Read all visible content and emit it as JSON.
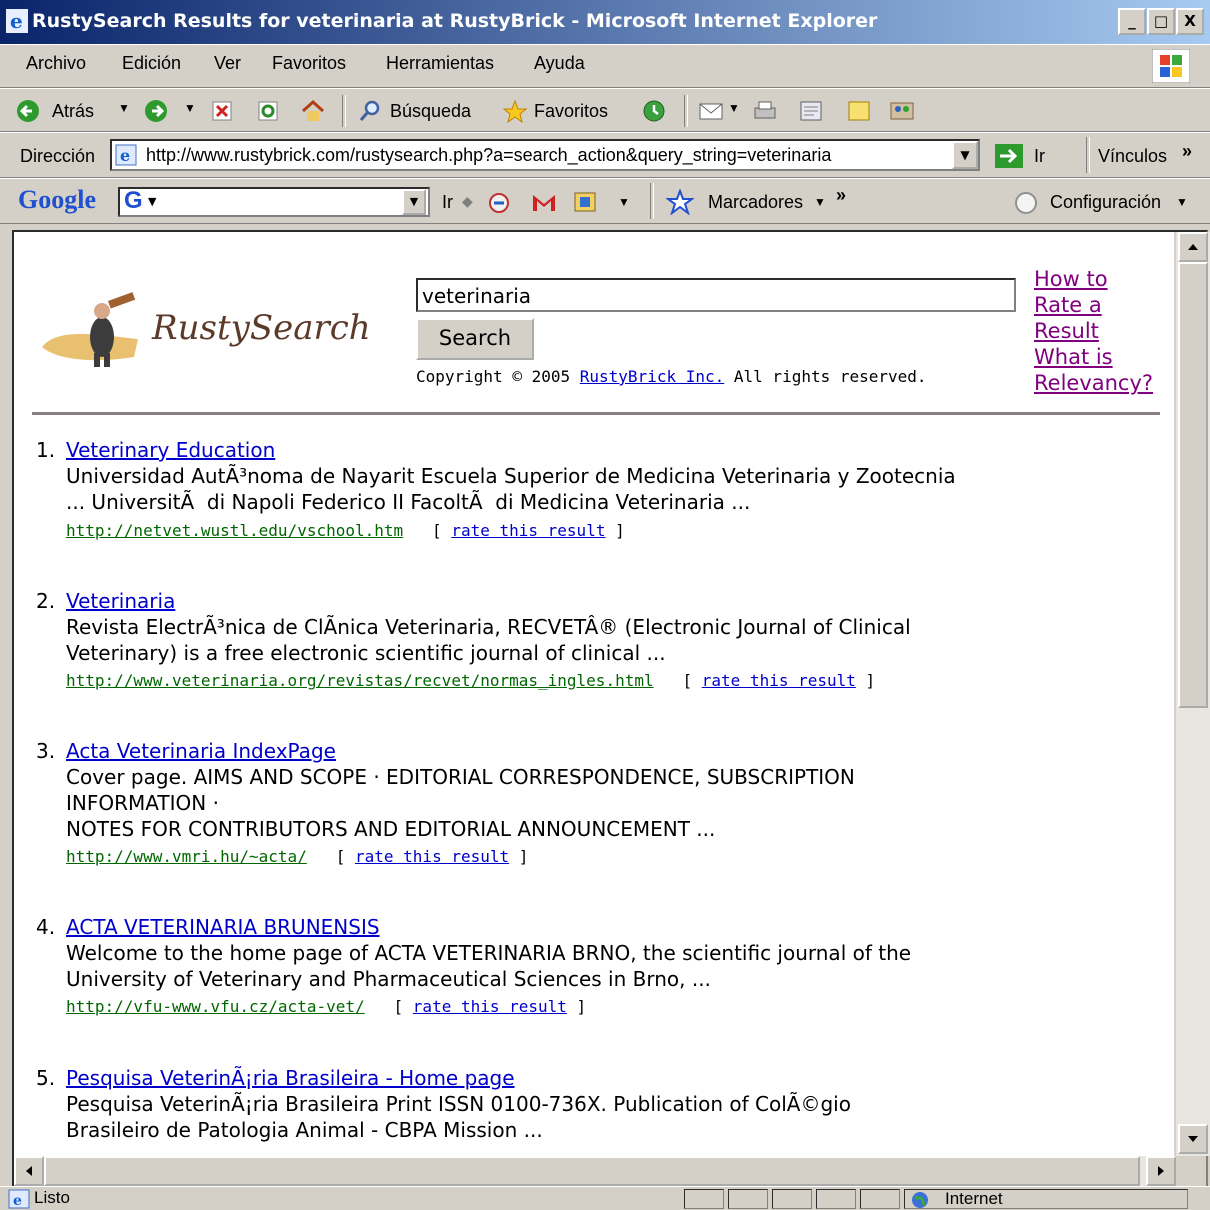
{
  "window": {
    "title": "RustySearch Results for veterinaria at RustyBrick - Microsoft Internet Explorer",
    "min_label": "_",
    "max_label": "□",
    "close_label": "X"
  },
  "menu": {
    "items": [
      "Archivo",
      "Edición",
      "Ver",
      "Favoritos",
      "Herramientas",
      "Ayuda"
    ]
  },
  "toolbar": {
    "back_label": "Atrás",
    "search_label": "Búsqueda",
    "favorites_label": "Favoritos"
  },
  "address": {
    "label": "Dirección",
    "url": "http://www.rustybrick.com/rustysearch.php?a=search_action&query_string=veterinaria",
    "go_label": "Ir",
    "links_label": "Vínculos",
    "more": "»"
  },
  "google_bar": {
    "logo": "Google",
    "g_icon": "G",
    "go_label": "Ir",
    "bookmarks_label": "Marcadores",
    "more": "»",
    "settings_label": "Configuración"
  },
  "page": {
    "brand": "RustySearch",
    "query": "veterinaria",
    "search_button": "Search",
    "copyright_prefix": "Copyright © 2005 ",
    "copyright_link": "RustyBrick Inc.",
    "copyright_suffix": " All rights reserved.",
    "help_links": [
      "How to",
      "Rate a",
      "Result",
      "What is",
      "Relevancy?"
    ],
    "rate_label": "rate this result",
    "results": [
      {
        "num": "1.",
        "title": "Veterinary Education",
        "snippet": "Universidad AutÃ³noma de Nayarit Escuela Superior de Medicina Veterinaria y Zootecnia\n... UniversitÃ  di Napoli Federico II FacoltÃ  di Medicina Veterinaria ...",
        "url": "http://netvet.wustl.edu/vschool.htm"
      },
      {
        "num": "2.",
        "title": "Veterinaria",
        "snippet": "Revista ElectrÃ³nica de ClÃnica Veterinaria, RECVETÂ® (Electronic Journal of Clinical\nVeterinary) is a free electronic scientific journal of clinical ...",
        "url": "http://www.veterinaria.org/revistas/recvet/normas_ingles.html"
      },
      {
        "num": "3.",
        "title": "Acta Veterinaria IndexPage",
        "snippet": "Cover page. AIMS AND SCOPE · EDITORIAL CORRESPONDENCE, SUBSCRIPTION\nINFORMATION ·\nNOTES FOR CONTRIBUTORS AND EDITORIAL ANNOUNCEMENT ...",
        "url": "http://www.vmri.hu/~acta/"
      },
      {
        "num": "4.",
        "title": "ACTA VETERINARIA BRUNENSIS",
        "snippet": "Welcome to the home page of ACTA VETERINARIA BRNO, the scientific journal of the\nUniversity of Veterinary and Pharmaceutical Sciences in Brno, ...",
        "url": "http://vfu-www.vfu.cz/acta-vet/"
      },
      {
        "num": "5.",
        "title": "Pesquisa VeterinÃ¡ria Brasileira - Home page",
        "snippet": "Pesquisa VeterinÃ¡ria Brasileira Print ISSN 0100-736X. Publication of ColÃ©gio\nBrasileiro de Patologia Animal - CBPA Mission ...",
        "url": ""
      }
    ]
  },
  "status": {
    "text": "Listo",
    "zone": "Internet"
  }
}
